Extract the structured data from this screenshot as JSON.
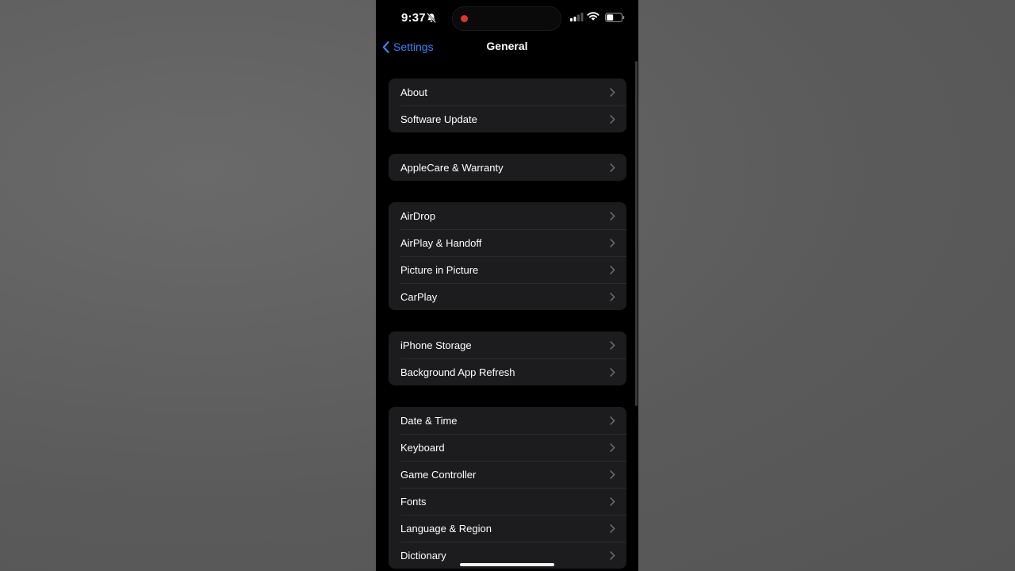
{
  "status": {
    "time": "9:37"
  },
  "nav": {
    "back_label": "Settings",
    "title": "General"
  },
  "groups": [
    {
      "items": [
        {
          "label": "About"
        },
        {
          "label": "Software Update"
        }
      ]
    },
    {
      "items": [
        {
          "label": "AppleCare & Warranty"
        }
      ]
    },
    {
      "items": [
        {
          "label": "AirDrop"
        },
        {
          "label": "AirPlay & Handoff"
        },
        {
          "label": "Picture in Picture"
        },
        {
          "label": "CarPlay"
        }
      ]
    },
    {
      "items": [
        {
          "label": "iPhone Storage"
        },
        {
          "label": "Background App Refresh"
        }
      ]
    },
    {
      "items": [
        {
          "label": "Date & Time"
        },
        {
          "label": "Keyboard"
        },
        {
          "label": "Game Controller"
        },
        {
          "label": "Fonts"
        },
        {
          "label": "Language & Region"
        },
        {
          "label": "Dictionary"
        }
      ]
    }
  ],
  "colors": {
    "accent": "#3a82f7",
    "record": "#e0322e",
    "cell": "#1c1c1e",
    "background": "#000000"
  },
  "icons": [
    "bell-slash-icon",
    "signal-icon",
    "wifi-icon",
    "battery-icon",
    "chevron-left-icon",
    "chevron-right-icon"
  ]
}
